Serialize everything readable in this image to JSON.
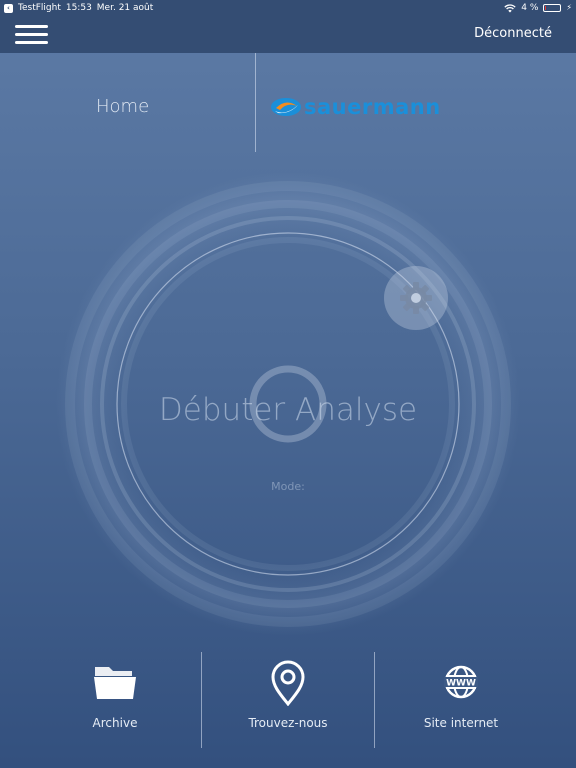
{
  "status_bar": {
    "back_app": "TestFlight",
    "time": "15:53",
    "date": "Mer. 21 août",
    "battery": "4 %",
    "battery_level": 0.04,
    "battery_color": "#e53935"
  },
  "navbar": {
    "menu_icon": "hamburger-icon",
    "disconnect_label": "Déconnecté"
  },
  "header": {
    "title": "Home",
    "logo_text": "sauermann",
    "logo_color": "#1b8fd9",
    "logo_accent": "#f28c1e"
  },
  "main": {
    "start_label": "Débuter Analyse",
    "mode_label": "Mode:",
    "settings_icon": "gear-icon"
  },
  "bottom_nav": [
    {
      "label": "Archive",
      "icon": "folder-icon"
    },
    {
      "label": "Trouvez-nous",
      "icon": "map-pin-icon"
    },
    {
      "label": "Site internet",
      "icon": "www-globe-icon"
    }
  ]
}
